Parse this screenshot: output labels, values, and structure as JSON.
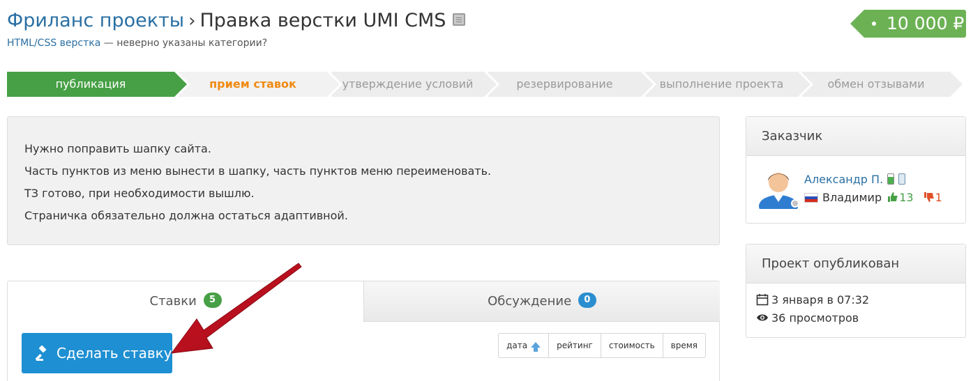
{
  "header": {
    "crumb": "Фриланс проекты",
    "separator": "›",
    "project_title": "Правка верстки UMI CMS",
    "category": "HTML/CSS верстка",
    "category_note": " — неверно указаны категории?",
    "price": "10 000 ₽"
  },
  "steps": [
    {
      "label": "публикация",
      "state": "done"
    },
    {
      "label": "прием ставок",
      "state": "current"
    },
    {
      "label": "утверждение условий",
      "state": "pending"
    },
    {
      "label": "резервирование",
      "state": "pending"
    },
    {
      "label": "выполнение проекта",
      "state": "pending"
    },
    {
      "label": "обмен отзывами",
      "state": "pending"
    }
  ],
  "description": [
    "Нужно поправить шапку сайта.",
    "Часть пунктов из меню вынести в шапку, часть пунктов меню переименовать.",
    "ТЗ готово, при необходимости вышлю.",
    "Страничка обязательно должна остаться адаптивной."
  ],
  "tabs": {
    "bids_label": "Ставки",
    "bids_count": "5",
    "discussion_label": "Обсуждение",
    "discussion_count": "0"
  },
  "bid_button": "Сделать ставку",
  "sort": {
    "date": "дата",
    "rating": "рейтинг",
    "cost": "стоимость",
    "time": "время"
  },
  "customer": {
    "heading": "Заказчик",
    "name": "Александр П.",
    "city": "Владимир",
    "positive": "13",
    "negative": "1"
  },
  "published": {
    "heading": "Проект опубликован",
    "date": "3 января в 07:32",
    "views": "36 просмотров"
  },
  "colors": {
    "accent_blue": "#1e8fd2",
    "success_green": "#47a046",
    "current_orange": "#f08a12",
    "link_blue": "#2a6fa3",
    "annotation_red": "#c0101e"
  }
}
